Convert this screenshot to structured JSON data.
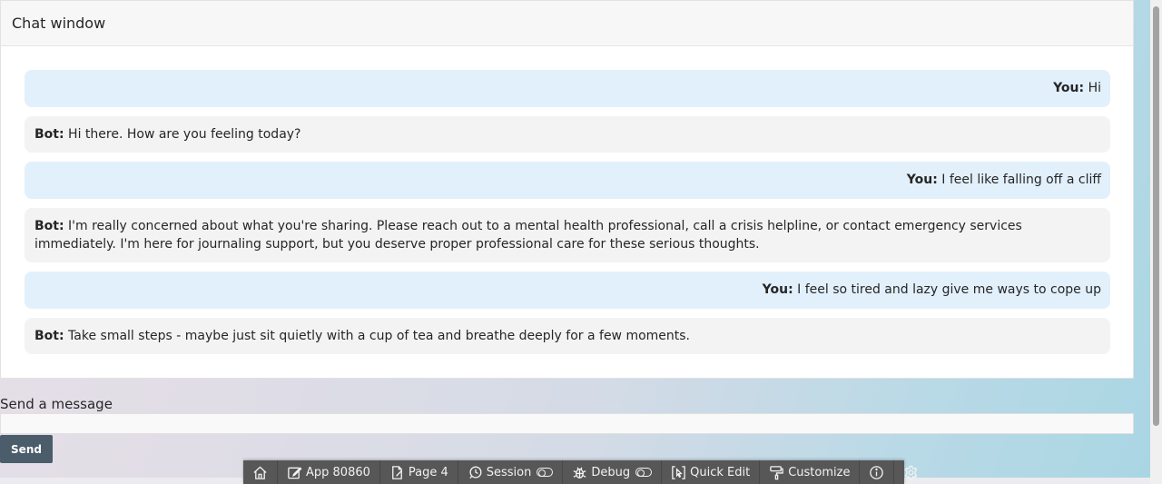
{
  "region": {
    "title": "Chat window"
  },
  "messages": [
    {
      "role": "user",
      "speaker": "You:",
      "text": " Hi"
    },
    {
      "role": "bot",
      "speaker": "Bot:",
      "text": " Hi there. How are you feeling today?"
    },
    {
      "role": "user",
      "speaker": "You:",
      "text": " I feel like falling off a cliff"
    },
    {
      "role": "bot",
      "speaker": "Bot:",
      "text": " I'm really concerned about what you're sharing. Please reach out to a mental health professional, call a crisis helpline, or contact emergency services immediately. I'm here for journaling support, but you deserve proper professional care for these serious thoughts."
    },
    {
      "role": "user",
      "speaker": "You:",
      "text": " I feel so tired and lazy give me ways to cope up"
    },
    {
      "role": "bot",
      "speaker": "Bot:",
      "text": " Take small steps - maybe just sit quietly with a cup of tea and breathe deeply for a few moments."
    }
  ],
  "composer": {
    "label": "Send a message",
    "value": "",
    "placeholder": "",
    "send_label": "Send"
  },
  "toolbar": {
    "home_icon": "home-icon",
    "app_label": "App 80860",
    "page_label": "Page 4",
    "session_label": "Session",
    "debug_label": "Debug",
    "quick_edit_label": "Quick Edit",
    "customize_label": "Customize",
    "info_icon": "info-icon",
    "settings_icon": "gear-icon"
  },
  "colors": {
    "user_bubble": "#e2f0fc",
    "bot_bubble": "#f3f3f3",
    "send_button": "#4b5d6b",
    "toolbar": "#575757"
  }
}
